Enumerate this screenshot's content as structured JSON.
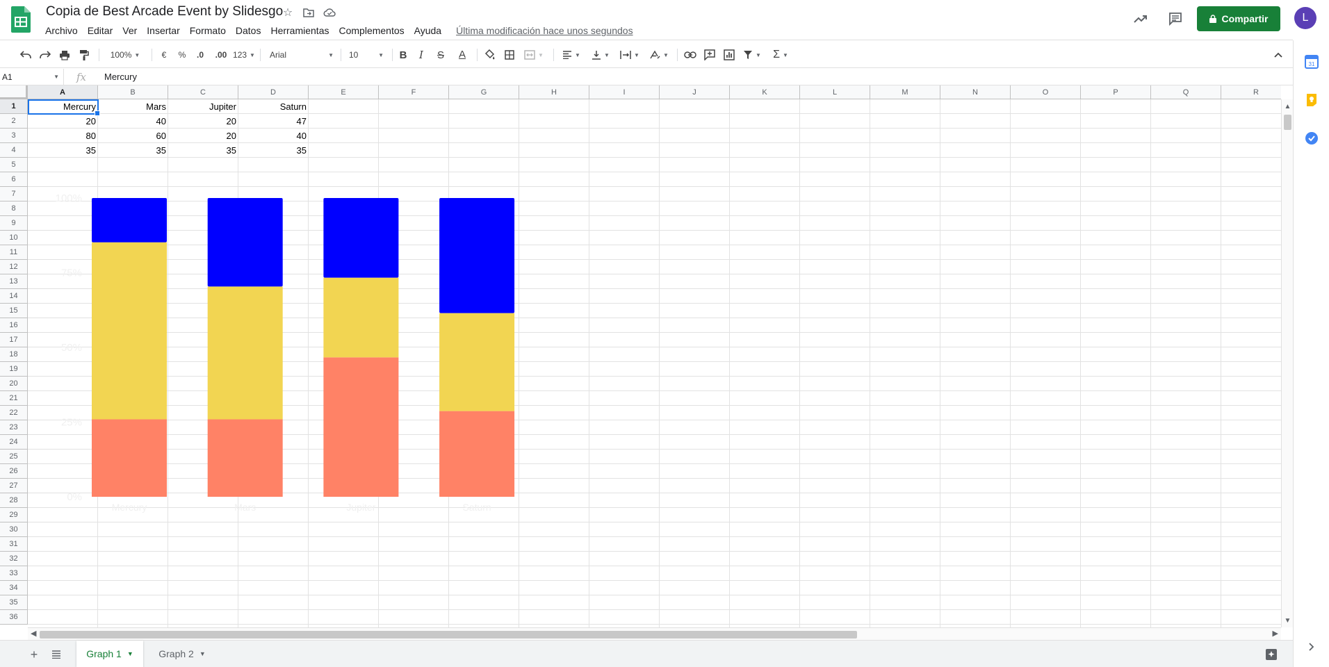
{
  "header": {
    "title": "Copia de Best Arcade Event by Slidesgo",
    "menu": [
      "Archivo",
      "Editar",
      "Ver",
      "Insertar",
      "Formato",
      "Datos",
      "Herramientas",
      "Complementos",
      "Ayuda"
    ],
    "last_edit": "Última modificación hace unos segundos",
    "share_label": "Compartir",
    "avatar_letter": "L",
    "share_color": "#188038"
  },
  "toolbar": {
    "zoom": "100%",
    "currency": "€",
    "percent": "%",
    "decrease_decimals": ".0",
    "increase_decimals": ".00",
    "number_format": "123",
    "font": "Arial",
    "font_size": "10",
    "bold": "B",
    "italic": "I",
    "strike": "S",
    "text_color_label": "A",
    "sum": "Σ"
  },
  "formula_bar": {
    "name_box": "A1",
    "fx": "fx",
    "content": "Mercury"
  },
  "columns": [
    "A",
    "B",
    "C",
    "D",
    "E",
    "F",
    "G",
    "H",
    "I",
    "J",
    "K",
    "L",
    "M",
    "N",
    "O",
    "P",
    "Q",
    "R"
  ],
  "rows": [
    "1",
    "2",
    "3",
    "4",
    "5",
    "6",
    "7",
    "8",
    "9",
    "10",
    "11",
    "12",
    "13",
    "14",
    "15",
    "16",
    "17",
    "18",
    "19",
    "20",
    "21",
    "22",
    "23",
    "24",
    "25",
    "26",
    "27",
    "28",
    "29",
    "30",
    "31",
    "32",
    "33",
    "34",
    "35",
    "36"
  ],
  "cells": [
    [
      "Mercury",
      "Mars",
      "Jupiter",
      "Saturn"
    ],
    [
      "20",
      "40",
      "20",
      "47"
    ],
    [
      "80",
      "60",
      "20",
      "40"
    ],
    [
      "35",
      "35",
      "35",
      "35"
    ]
  ],
  "chart_data": {
    "type": "bar",
    "stacked": "percent",
    "categories": [
      "Mercury",
      "Mars",
      "Jupiter",
      "Saturn"
    ],
    "series": [
      {
        "values": [
          35,
          35,
          35,
          35
        ],
        "color": "#ff8266"
      },
      {
        "values": [
          80,
          60,
          20,
          40
        ],
        "color": "#f2d552"
      },
      {
        "values": [
          20,
          40,
          20,
          47
        ],
        "color": "#0000ff"
      }
    ],
    "yticks": [
      "0%",
      "25%",
      "50%",
      "75%",
      "100%"
    ],
    "ylim": [
      0,
      100
    ],
    "grid": false
  },
  "sheets": {
    "tabs": [
      {
        "label": "Graph 1",
        "active": true
      },
      {
        "label": "Graph 2",
        "active": false
      }
    ]
  }
}
